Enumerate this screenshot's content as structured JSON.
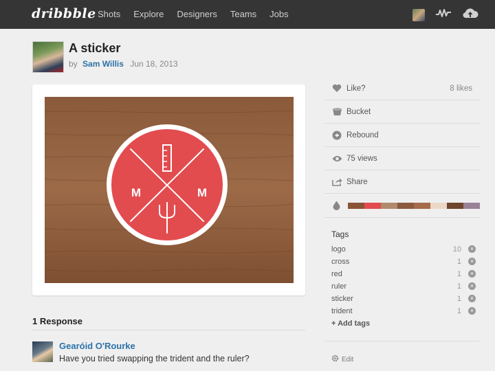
{
  "nav": {
    "logo": "dribbble",
    "links": [
      "Shots",
      "Explore",
      "Designers",
      "Teams",
      "Jobs"
    ]
  },
  "shot": {
    "title": "A sticker",
    "by": "by",
    "author": "Sam Willis",
    "date": "Jun 18, 2013",
    "sticker_letters": [
      "M",
      "M"
    ]
  },
  "sidebar": {
    "like_label": "Like?",
    "likes_count": "8 likes",
    "bucket_label": "Bucket",
    "rebound_label": "Rebound",
    "views_label": "75 views",
    "share_label": "Share",
    "palette": [
      "#8a5436",
      "#e24c4f",
      "#b08a6c",
      "#8a5a3f",
      "#a66b4b",
      "#ecd8c9",
      "#6e452d",
      "#9a8296"
    ]
  },
  "tags": {
    "heading": "Tags",
    "items": [
      {
        "name": "logo",
        "count": "10"
      },
      {
        "name": "cross",
        "count": "1"
      },
      {
        "name": "red",
        "count": "1"
      },
      {
        "name": "ruler",
        "count": "1"
      },
      {
        "name": "sticker",
        "count": "1"
      },
      {
        "name": "trident",
        "count": "1"
      }
    ],
    "add_label": "+ Add tags",
    "edit_label": "Edit"
  },
  "responses": {
    "heading": "1 Response",
    "items": [
      {
        "name": "Gearóid O'Rourke",
        "text": "Have you tried swapping the trident and the ruler?"
      }
    ]
  }
}
